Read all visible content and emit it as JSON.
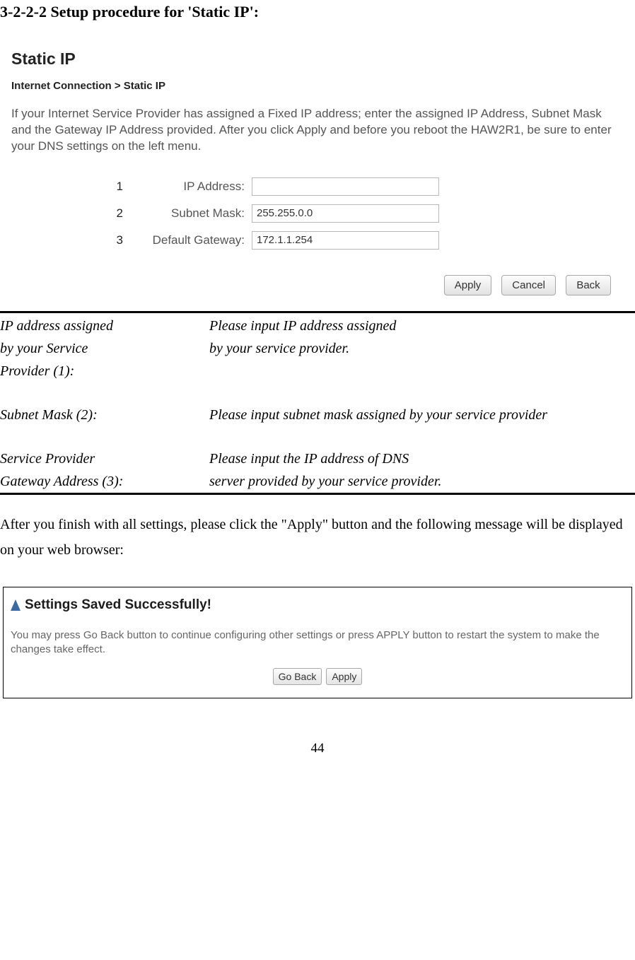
{
  "heading": "3-2-2-2 Setup procedure for 'Static IP':",
  "screenshot1": {
    "title": "Static IP",
    "breadcrumb_prefix": "Internet Connection >",
    "breadcrumb_current": " Static IP",
    "description": "If your Internet Service Provider has assigned a Fixed IP address; enter the assigned IP Address, Subnet Mask and the Gateway IP Address provided. After you click Apply and before you reboot the HAW2R1, be sure to enter your DNS settings on the left menu.",
    "rows": [
      {
        "num": "1",
        "label": "IP Address:",
        "value": ""
      },
      {
        "num": "2",
        "label": "Subnet Mask:",
        "value": "255.255.0.0"
      },
      {
        "num": "3",
        "label": "Default Gateway:",
        "value": "172.1.1.254"
      }
    ],
    "buttons": {
      "apply": "Apply",
      "cancel": "Cancel",
      "back": "Back"
    }
  },
  "descTable": {
    "r1": {
      "l1": "IP address assigned",
      "l2": "by your Service",
      "l3": "Provider (1):",
      "r1": "Please input IP address assigned",
      "r2": "by your service provider."
    },
    "r2": {
      "l1": "Subnet Mask (2):",
      "r1": "Please input subnet mask assigned by your service provider"
    },
    "r3": {
      "l1": "Service Provider",
      "l2": "Gateway Address (3):",
      "r1": "Please input the IP address of DNS",
      "r2": "server provided by your service provider."
    }
  },
  "paragraph": "After you finish with all settings, please click the \"Apply\" button and the following message will be displayed on your web browser:",
  "screenshot2": {
    "title": "Settings Saved Successfully!",
    "description": "You may press Go Back button to continue configuring other settings or press APPLY button to restart the system to make the changes take effect.",
    "buttons": {
      "goback": "Go Back",
      "apply": "Apply"
    }
  },
  "pageNumber": "44"
}
